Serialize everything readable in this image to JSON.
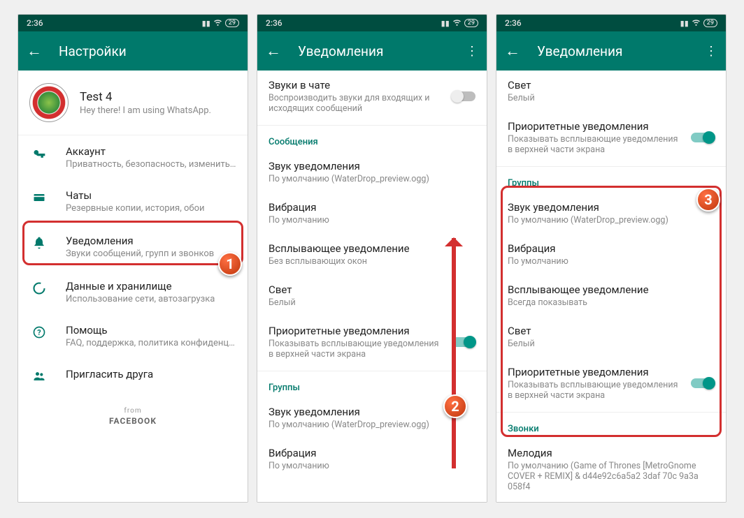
{
  "status": {
    "time": "2:36",
    "battery": "29"
  },
  "screen1": {
    "title": "Настройки",
    "profile": {
      "name": "Test 4",
      "status": "Hey there! I am using WhatsApp."
    },
    "items": [
      {
        "title": "Аккаунт",
        "sub": "Приватность, безопасность, изменить номер"
      },
      {
        "title": "Чаты",
        "sub": "Резервные копии, история, обои"
      },
      {
        "title": "Уведомления",
        "sub": "Звуки сообщений, групп и звонков"
      },
      {
        "title": "Данные и хранилище",
        "sub": "Использование сети, автозагрузка"
      },
      {
        "title": "Помощь",
        "sub": "FAQ, поддержка, политика конфиденциальн..."
      },
      {
        "title": "Пригласить друга",
        "sub": ""
      }
    ],
    "from": "from",
    "facebook": "FACEBOOK"
  },
  "screen2": {
    "title": "Уведомления",
    "chat_sounds": {
      "title": "Звуки в чате",
      "sub": "Воспроизводить звуки для входящих и исходящих сообщений"
    },
    "sec_messages": "Сообщения",
    "items": [
      {
        "title": "Звук уведомления",
        "sub": "По умолчанию (WaterDrop_preview.ogg)"
      },
      {
        "title": "Вибрация",
        "sub": "По умолчанию"
      },
      {
        "title": "Всплывающее уведомление",
        "sub": "Без всплывающих окон"
      },
      {
        "title": "Свет",
        "sub": "Белый"
      }
    ],
    "priority": {
      "title": "Приоритетные уведомления",
      "sub": "Показывать всплывающие уведомления в верхней части экрана"
    },
    "sec_groups": "Группы",
    "g_items": [
      {
        "title": "Звук уведомления",
        "sub": "По умолчанию (WaterDrop_preview.ogg)"
      },
      {
        "title": "Вибрация",
        "sub": "По умолчанию"
      }
    ]
  },
  "screen3": {
    "title": "Уведомления",
    "light": {
      "title": "Свет",
      "sub": "Белый"
    },
    "priority": {
      "title": "Приоритетные уведомления",
      "sub": "Показывать всплывающие уведомления в верхней части экрана"
    },
    "sec_groups": "Группы",
    "g_items": [
      {
        "title": "Звук уведомления",
        "sub": "По умолчанию (WaterDrop_preview.ogg)"
      },
      {
        "title": "Вибрация",
        "sub": "По умолчанию"
      },
      {
        "title": "Всплывающее уведомление",
        "sub": "Всегда показывать"
      },
      {
        "title": "Свет",
        "sub": "Белый"
      }
    ],
    "g_priority": {
      "title": "Приоритетные уведомления",
      "sub": "Показывать всплывающие уведомления в верхней части экрана"
    },
    "sec_calls": "Звонки",
    "ringtone": {
      "title": "Мелодия",
      "sub": "По умолчанию (Game of Thrones [MetroGnome COVER + REMIX] & d44e92c6a5a2 3daf 70c 9a3a 058f4"
    }
  },
  "callouts": {
    "c1": "1",
    "c2": "2",
    "c3": "3"
  }
}
